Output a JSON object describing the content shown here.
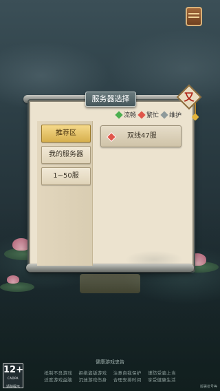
{
  "panel": {
    "title": "服务器选择",
    "close_glyph": "又"
  },
  "legend": [
    {
      "label": "流畅",
      "color": "#4caf50"
    },
    {
      "label": "繁忙",
      "color": "#e0564a"
    },
    {
      "label": "维护",
      "color": "#8e9a9b"
    }
  ],
  "sidebar": {
    "items": [
      {
        "label": "推荐区",
        "active": true
      },
      {
        "label": "我的服务器",
        "active": false
      },
      {
        "label": "1~50服",
        "active": false
      }
    ]
  },
  "servers": [
    {
      "name": "双线47服",
      "status": "繁忙",
      "status_color": "#e0564a"
    }
  ],
  "footer": {
    "age_rating": "12+",
    "age_org": "CADPA",
    "age_caption": "适龄提示",
    "health_title": "健康游戏忠告",
    "health_lines": [
      "抵制不良游戏    拒绝盗版游戏    注意自我保护    谨防受骗上当",
      "适度游戏益脑    沉迷游戏伤身    合理安排时间    享受健康生活"
    ],
    "version": "版署批号等"
  }
}
